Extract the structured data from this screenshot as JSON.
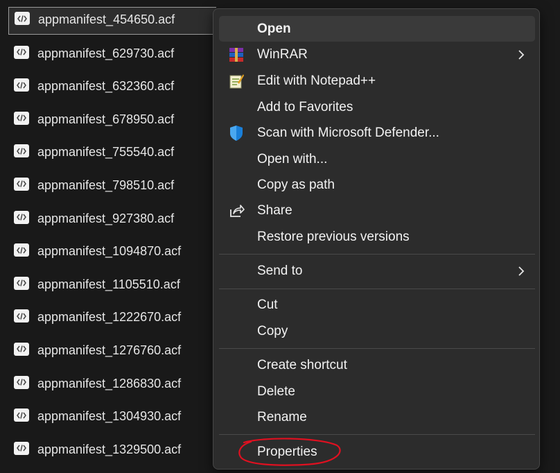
{
  "files": [
    {
      "name": "appmanifest_454650.acf",
      "icon": "acf-file-icon",
      "selected": true
    },
    {
      "name": "appmanifest_629730.acf",
      "icon": "acf-file-icon"
    },
    {
      "name": "appmanifest_632360.acf",
      "icon": "acf-file-icon"
    },
    {
      "name": "appmanifest_678950.acf",
      "icon": "acf-file-icon"
    },
    {
      "name": "appmanifest_755540.acf",
      "icon": "acf-file-icon"
    },
    {
      "name": "appmanifest_798510.acf",
      "icon": "acf-file-icon"
    },
    {
      "name": "appmanifest_927380.acf",
      "icon": "acf-file-icon"
    },
    {
      "name": "appmanifest_1094870.acf",
      "icon": "acf-file-icon"
    },
    {
      "name": "appmanifest_1105510.acf",
      "icon": "acf-file-icon"
    },
    {
      "name": "appmanifest_1222670.acf",
      "icon": "acf-file-icon"
    },
    {
      "name": "appmanifest_1276760.acf",
      "icon": "acf-file-icon"
    },
    {
      "name": "appmanifest_1286830.acf",
      "icon": "acf-file-icon"
    },
    {
      "name": "appmanifest_1304930.acf",
      "icon": "acf-file-icon"
    },
    {
      "name": "appmanifest_1329500.acf",
      "icon": "acf-file-icon"
    }
  ],
  "context_menu": {
    "open": "Open",
    "winrar": "WinRAR",
    "edit_notepadpp": "Edit with Notepad++",
    "add_favorites": "Add to Favorites",
    "scan_defender": "Scan with Microsoft Defender...",
    "open_with": "Open with...",
    "copy_as_path": "Copy as path",
    "share": "Share",
    "restore_versions": "Restore previous versions",
    "send_to": "Send to",
    "cut": "Cut",
    "copy": "Copy",
    "create_shortcut": "Create shortcut",
    "delete": "Delete",
    "rename": "Rename",
    "properties": "Properties"
  },
  "icons": {
    "winrar": "winrar-icon",
    "notepadpp": "notepadpp-icon",
    "defender": "defender-shield-icon",
    "share": "share-icon",
    "submenu": "chevron-right-icon"
  },
  "colors": {
    "background": "#191919",
    "menu_background": "#2c2c2c",
    "menu_hover": "#3a3a3a",
    "text": "#f2f2f2",
    "annotation": "#e01020"
  }
}
